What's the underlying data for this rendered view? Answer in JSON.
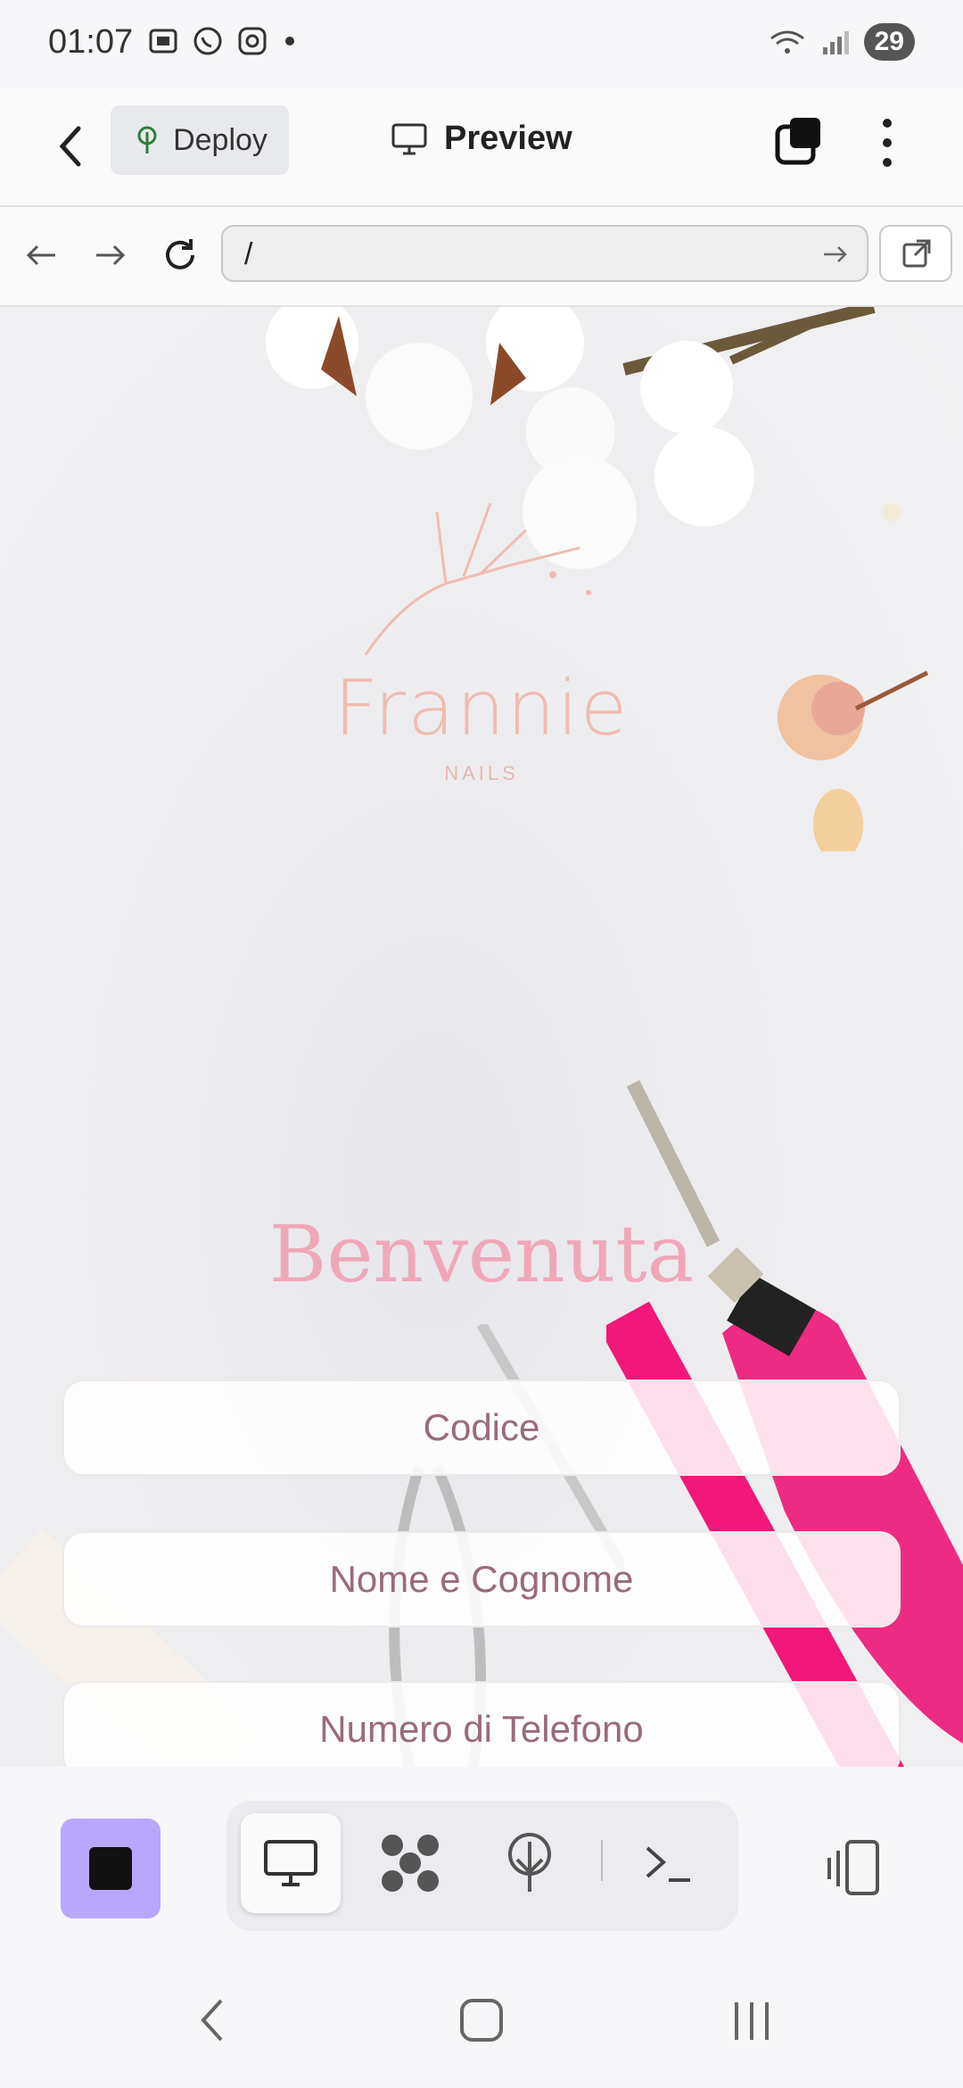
{
  "status_bar": {
    "time": "01:07",
    "battery": "29",
    "icons": [
      "screenshot-icon",
      "whatsapp-icon",
      "instagram-icon",
      "dot-icon",
      "wifi-icon",
      "signal-icon"
    ]
  },
  "app_bar": {
    "deploy_label": "Deploy",
    "preview_label": "Preview"
  },
  "browser": {
    "url_value": "/"
  },
  "site": {
    "logo_name": "Frannie",
    "logo_sub": "NAILS",
    "welcome": "Benvenuta",
    "fields": [
      {
        "placeholder": "Codice"
      },
      {
        "placeholder": "Nome e Cognome"
      },
      {
        "placeholder": "Numero di Telefono"
      }
    ]
  },
  "colors": {
    "accent": "#b9a6ff",
    "brand_pink": "#f0a8b9",
    "field_text": "#9a6a7c"
  },
  "toolbar": {
    "tools": [
      "monitor-icon",
      "network-icon",
      "deploy-tree-icon",
      "terminal-icon"
    ],
    "active_tool": "monitor-icon"
  }
}
